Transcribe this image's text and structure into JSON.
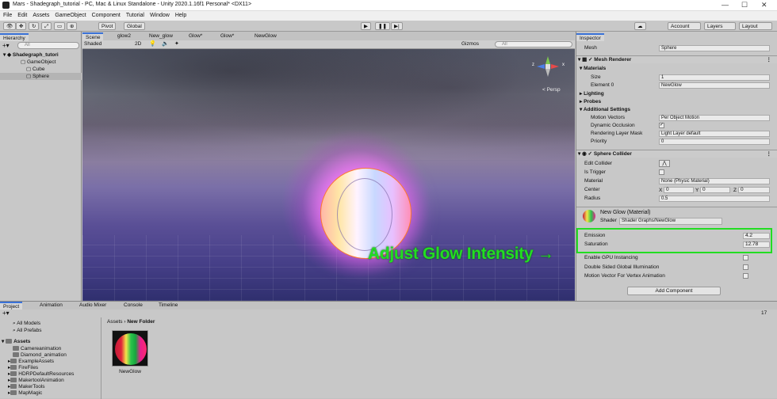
{
  "window": {
    "title": "Mars - Shadegraph_tutorial - PC, Mac & Linux Standalone - Unity 2020.1.16f1 Personal* <DX11>"
  },
  "menu": [
    "File",
    "Edit",
    "Assets",
    "GameObject",
    "Component",
    "Tutorial",
    "Window",
    "Help"
  ],
  "toolbar": {
    "pivot": "Pivot",
    "global": "Global",
    "account": "Account",
    "layers": "Layers",
    "layout": "Layout"
  },
  "hierarchy": {
    "tab": "Hierarchy",
    "search_placeholder": "All",
    "items": [
      {
        "label": "Shadegraph_tutori"
      },
      {
        "label": "GameObject"
      },
      {
        "label": "Cube"
      },
      {
        "label": "Sphere"
      }
    ]
  },
  "scene": {
    "tabs": [
      "Scene",
      "glow2",
      "New_glow",
      "Glow*",
      "Glow*",
      "NewGlow"
    ],
    "shading": "Shaded",
    "mode_2d": "2D",
    "gizmos": "Gizmos",
    "search_placeholder": "All",
    "persp": "< Persp",
    "axis_z": "z",
    "axis_x": "x",
    "annotation": "Adjust Glow Intensity →"
  },
  "inspector": {
    "tab": "Inspector",
    "mesh_label": "Mesh",
    "mesh_value": "Sphere",
    "mesh_renderer": "Mesh Renderer",
    "materials": "Materials",
    "size_label": "Size",
    "size_value": "1",
    "element0_label": "Element 0",
    "element0_value": "NewGlow",
    "lighting": "Lighting",
    "probes": "Probes",
    "additional": "Additional Settings",
    "motion_label": "Motion Vectors",
    "motion_value": "Per Object Motion",
    "dynamic_label": "Dynamic Occlusion",
    "rlm_label": "Rendering Layer Mask",
    "rlm_value": "Light Layer default",
    "priority_label": "Priority",
    "priority_value": "0",
    "sphere_collider": "Sphere Collider",
    "edit_collider": "Edit Collider",
    "is_trigger": "Is Trigger",
    "material_label": "Material",
    "material_value": "None (Physic Material)",
    "center_label": "Center",
    "cx": "0",
    "cy": "0",
    "cz": "0",
    "radius_label": "Radius",
    "radius_value": "0.5",
    "mat_name": "New Glow (Material)",
    "shader_label": "Shader",
    "shader_value": "Shader Graphs/NewGlow",
    "emission_label": "Emission",
    "emission_value": "4.2",
    "saturation_label": "Saturation",
    "saturation_value": "12.78",
    "gpu_inst": "Enable GPU Instancing",
    "double_sided": "Double Sided Global Illumination",
    "motion_vertex": "Motion Vector For Vertex Animation",
    "add_component": "Add Component"
  },
  "bottom": {
    "tabs": [
      "Project",
      "Animation",
      "Audio Mixer",
      "Console",
      "Timeline"
    ],
    "count": "17",
    "favorites": [
      "All Models",
      "All Prefabs"
    ],
    "assets_root": "Assets",
    "folders": [
      "Camereanimation",
      "Diamond_animation",
      "ExampleAssets",
      "FireFiles",
      "HDRPDefaultResources",
      "MakertoolAnimation",
      "MakerTools",
      "MapMagic"
    ],
    "breadcrumb_root": "Assets",
    "breadcrumb_sep": "›",
    "breadcrumb_leaf": "New Folder",
    "asset_name": "NewGlow"
  }
}
